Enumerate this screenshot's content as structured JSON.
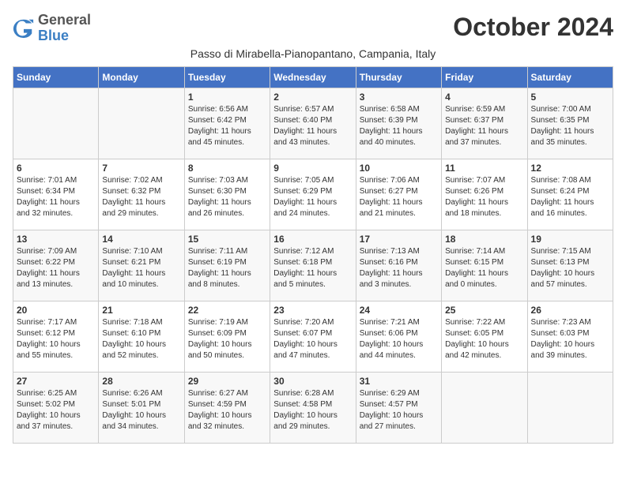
{
  "header": {
    "logo_general": "General",
    "logo_blue": "Blue",
    "month_title": "October 2024",
    "subtitle": "Passo di Mirabella-Pianopantano, Campania, Italy"
  },
  "weekdays": [
    "Sunday",
    "Monday",
    "Tuesday",
    "Wednesday",
    "Thursday",
    "Friday",
    "Saturday"
  ],
  "weeks": [
    [
      {
        "day": "",
        "info": ""
      },
      {
        "day": "",
        "info": ""
      },
      {
        "day": "1",
        "info": "Sunrise: 6:56 AM\nSunset: 6:42 PM\nDaylight: 11 hours\nand 45 minutes."
      },
      {
        "day": "2",
        "info": "Sunrise: 6:57 AM\nSunset: 6:40 PM\nDaylight: 11 hours\nand 43 minutes."
      },
      {
        "day": "3",
        "info": "Sunrise: 6:58 AM\nSunset: 6:39 PM\nDaylight: 11 hours\nand 40 minutes."
      },
      {
        "day": "4",
        "info": "Sunrise: 6:59 AM\nSunset: 6:37 PM\nDaylight: 11 hours\nand 37 minutes."
      },
      {
        "day": "5",
        "info": "Sunrise: 7:00 AM\nSunset: 6:35 PM\nDaylight: 11 hours\nand 35 minutes."
      }
    ],
    [
      {
        "day": "6",
        "info": "Sunrise: 7:01 AM\nSunset: 6:34 PM\nDaylight: 11 hours\nand 32 minutes."
      },
      {
        "day": "7",
        "info": "Sunrise: 7:02 AM\nSunset: 6:32 PM\nDaylight: 11 hours\nand 29 minutes."
      },
      {
        "day": "8",
        "info": "Sunrise: 7:03 AM\nSunset: 6:30 PM\nDaylight: 11 hours\nand 26 minutes."
      },
      {
        "day": "9",
        "info": "Sunrise: 7:05 AM\nSunset: 6:29 PM\nDaylight: 11 hours\nand 24 minutes."
      },
      {
        "day": "10",
        "info": "Sunrise: 7:06 AM\nSunset: 6:27 PM\nDaylight: 11 hours\nand 21 minutes."
      },
      {
        "day": "11",
        "info": "Sunrise: 7:07 AM\nSunset: 6:26 PM\nDaylight: 11 hours\nand 18 minutes."
      },
      {
        "day": "12",
        "info": "Sunrise: 7:08 AM\nSunset: 6:24 PM\nDaylight: 11 hours\nand 16 minutes."
      }
    ],
    [
      {
        "day": "13",
        "info": "Sunrise: 7:09 AM\nSunset: 6:22 PM\nDaylight: 11 hours\nand 13 minutes."
      },
      {
        "day": "14",
        "info": "Sunrise: 7:10 AM\nSunset: 6:21 PM\nDaylight: 11 hours\nand 10 minutes."
      },
      {
        "day": "15",
        "info": "Sunrise: 7:11 AM\nSunset: 6:19 PM\nDaylight: 11 hours\nand 8 minutes."
      },
      {
        "day": "16",
        "info": "Sunrise: 7:12 AM\nSunset: 6:18 PM\nDaylight: 11 hours\nand 5 minutes."
      },
      {
        "day": "17",
        "info": "Sunrise: 7:13 AM\nSunset: 6:16 PM\nDaylight: 11 hours\nand 3 minutes."
      },
      {
        "day": "18",
        "info": "Sunrise: 7:14 AM\nSunset: 6:15 PM\nDaylight: 11 hours\nand 0 minutes."
      },
      {
        "day": "19",
        "info": "Sunrise: 7:15 AM\nSunset: 6:13 PM\nDaylight: 10 hours\nand 57 minutes."
      }
    ],
    [
      {
        "day": "20",
        "info": "Sunrise: 7:17 AM\nSunset: 6:12 PM\nDaylight: 10 hours\nand 55 minutes."
      },
      {
        "day": "21",
        "info": "Sunrise: 7:18 AM\nSunset: 6:10 PM\nDaylight: 10 hours\nand 52 minutes."
      },
      {
        "day": "22",
        "info": "Sunrise: 7:19 AM\nSunset: 6:09 PM\nDaylight: 10 hours\nand 50 minutes."
      },
      {
        "day": "23",
        "info": "Sunrise: 7:20 AM\nSunset: 6:07 PM\nDaylight: 10 hours\nand 47 minutes."
      },
      {
        "day": "24",
        "info": "Sunrise: 7:21 AM\nSunset: 6:06 PM\nDaylight: 10 hours\nand 44 minutes."
      },
      {
        "day": "25",
        "info": "Sunrise: 7:22 AM\nSunset: 6:05 PM\nDaylight: 10 hours\nand 42 minutes."
      },
      {
        "day": "26",
        "info": "Sunrise: 7:23 AM\nSunset: 6:03 PM\nDaylight: 10 hours\nand 39 minutes."
      }
    ],
    [
      {
        "day": "27",
        "info": "Sunrise: 6:25 AM\nSunset: 5:02 PM\nDaylight: 10 hours\nand 37 minutes."
      },
      {
        "day": "28",
        "info": "Sunrise: 6:26 AM\nSunset: 5:01 PM\nDaylight: 10 hours\nand 34 minutes."
      },
      {
        "day": "29",
        "info": "Sunrise: 6:27 AM\nSunset: 4:59 PM\nDaylight: 10 hours\nand 32 minutes."
      },
      {
        "day": "30",
        "info": "Sunrise: 6:28 AM\nSunset: 4:58 PM\nDaylight: 10 hours\nand 29 minutes."
      },
      {
        "day": "31",
        "info": "Sunrise: 6:29 AM\nSunset: 4:57 PM\nDaylight: 10 hours\nand 27 minutes."
      },
      {
        "day": "",
        "info": ""
      },
      {
        "day": "",
        "info": ""
      }
    ]
  ]
}
